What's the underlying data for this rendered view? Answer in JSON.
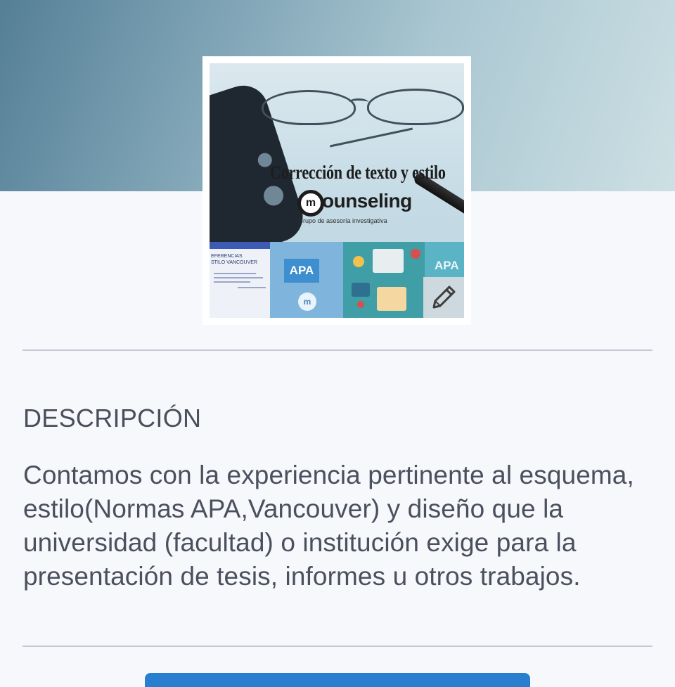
{
  "profile": {
    "image": {
      "headline": "Corrección de texto y estilo",
      "brand_initial": "m",
      "brand_name": "ounseling",
      "tagline": "Grupo de asesoría investigativa",
      "collage": {
        "doc_title_line1": "EFERENCIAS",
        "doc_title_line2": "STILO VANCOUVER",
        "apa_badge": "APA",
        "apa_logo": "m",
        "apa_label2": "APA"
      }
    },
    "edit_icon": "pencil-icon"
  },
  "description": {
    "title": "DESCRIPCIÓN",
    "text": "Contamos con la experiencia pertinente al esquema, estilo(Normas APA,Vancouver) y diseño que la universidad (facultad) o institución exige para la presentación de tesis, informes u otros trabajos."
  },
  "colors": {
    "banner_start": "#557f96",
    "banner_end": "#cde0e4",
    "background": "#f7f8fb",
    "text": "#4b505e",
    "divider": "#c6c9d3",
    "action_button": "#2a7ed0"
  }
}
